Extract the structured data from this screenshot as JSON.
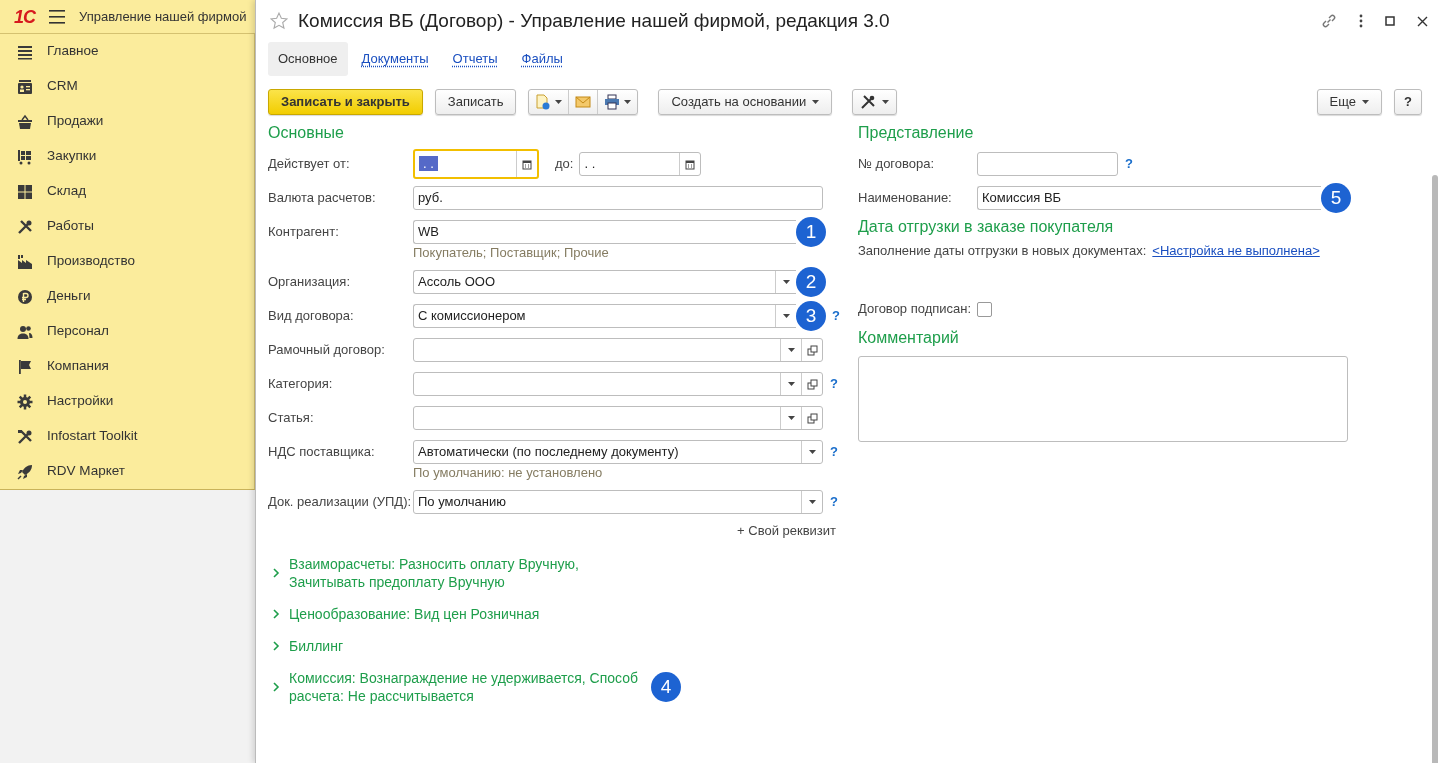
{
  "app": {
    "logo": "1С",
    "title": "Управление нашей фирмой"
  },
  "sidebar": {
    "items": [
      {
        "label": "Главное"
      },
      {
        "label": "CRM"
      },
      {
        "label": "Продажи"
      },
      {
        "label": "Закупки"
      },
      {
        "label": "Склад"
      },
      {
        "label": "Работы"
      },
      {
        "label": "Производство"
      },
      {
        "label": "Деньги"
      },
      {
        "label": "Персонал"
      },
      {
        "label": "Компания"
      },
      {
        "label": "Настройки"
      },
      {
        "label": "Infostart Toolkit"
      },
      {
        "label": "RDV Маркет"
      }
    ]
  },
  "form": {
    "title": "Комиссия ВБ (Договор) - Управление нашей фирмой, редакция 3.0"
  },
  "tabs": [
    {
      "label": "Основное",
      "selected": true
    },
    {
      "label": "Документы",
      "selected": false
    },
    {
      "label": "Отчеты",
      "selected": false
    },
    {
      "label": "Файлы",
      "selected": false
    }
  ],
  "toolbar": {
    "left": [
      {
        "kind": "primary",
        "label": "Записать и закрыть"
      },
      {
        "kind": "button",
        "label": "Записать"
      },
      {
        "kind": "icon_group"
      },
      {
        "kind": "menu",
        "label": "Создать на основании"
      },
      {
        "kind": "tools_menu"
      }
    ],
    "right": [
      {
        "kind": "menu",
        "label": "Еще"
      },
      {
        "kind": "button",
        "label": "?"
      }
    ]
  },
  "main": {
    "heading": "Основные",
    "fields": [
      {
        "kind": "date_range",
        "label": "Действует от:",
        "from": {
          "value": ". .",
          "focused": true
        },
        "to_label": "до:",
        "to": {
          "value": ". .",
          "focused": false
        }
      },
      {
        "kind": "text",
        "label": "Валюта расчетов:",
        "value": "руб."
      },
      {
        "kind": "text",
        "label": "Контрагент:",
        "value": "WB",
        "marker": "1",
        "note": "Покупатель; Поставщик; Прочие"
      },
      {
        "kind": "combo_open",
        "label": "Организация:",
        "value": "Ассоль ООО",
        "marker": "2"
      },
      {
        "kind": "combo_open",
        "label": "Вид договора:",
        "value": "С комиссионером",
        "marker": "3",
        "help": "?"
      },
      {
        "kind": "combo_open",
        "label": "Рамочный договор:"
      },
      {
        "kind": "combo_open",
        "label": "Категория:",
        "help": "?"
      },
      {
        "kind": "combo_open",
        "label": "Статья:"
      },
      {
        "kind": "combo",
        "label": "НДС поставщика:",
        "value": "Автоматически (по последнему документу)",
        "help": "?",
        "note": "По умолчанию: не установлено"
      },
      {
        "kind": "combo",
        "label": "Док. реализации (УПД):",
        "value": "По умолчанию",
        "help": "?"
      }
    ],
    "add_link": "+ Свой реквизит"
  },
  "groups": [
    {
      "label": "Взаиморасчеты: Разносить оплату Вручную, Зачитывать предоплату Вручную",
      "expanded": false
    },
    {
      "label": "Ценообразование: Вид цен Розничная",
      "expanded": false
    },
    {
      "label": "Биллинг",
      "expanded": false
    },
    {
      "label": "Комиссия: Вознаграждение не удерживается, Способ расчета: Не рассчитывается",
      "expanded": false,
      "marker": "4"
    }
  ],
  "presentation": {
    "heading": "Представление",
    "fields": [
      {
        "label": "№ договора:",
        "help": "?"
      },
      {
        "label": "Наименование:",
        "value": "Комиссия ВБ",
        "marker": "5"
      }
    ]
  },
  "shipping": {
    "heading": "Дата отгрузки в заказе покупателя",
    "label": "Заполнение даты отгрузки в новых документах:",
    "link": "<Настройка не выполнена>"
  },
  "signed": {
    "label": "Договор подписан:",
    "checked": false
  },
  "comment": {
    "heading": "Комментарий"
  }
}
